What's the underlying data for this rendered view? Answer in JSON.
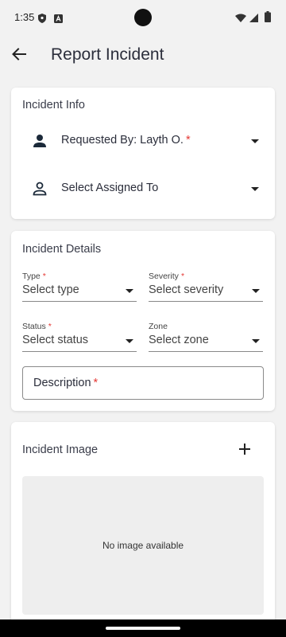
{
  "status_bar": {
    "time": "1:35"
  },
  "app_bar": {
    "title": "Report Incident",
    "back_icon": "arrow-back-icon"
  },
  "incident_info": {
    "title": "Incident Info",
    "requested_by": {
      "label": "Requested By: Layth O.",
      "required": "*",
      "icon": "person-filled-icon"
    },
    "assigned_to": {
      "label": "Select Assigned To",
      "icon": "person-outline-icon"
    }
  },
  "incident_details": {
    "title": "Incident Details",
    "type": {
      "label": "Type",
      "required": "*",
      "value": "Select type"
    },
    "severity": {
      "label": "Severity",
      "required": "*",
      "value": "Select severity"
    },
    "status": {
      "label": "Status",
      "required": "*",
      "value": "Select status"
    },
    "zone": {
      "label": "Zone",
      "value": "Select zone"
    },
    "description": {
      "label": "Description",
      "required": "*"
    }
  },
  "incident_image": {
    "title": "Incident Image",
    "add_icon": "plus-icon",
    "placeholder": "No image available"
  },
  "colors": {
    "background": "#f2f2f2",
    "card": "#ffffff",
    "required": "#e53935",
    "title_text": "#2b2e3b"
  }
}
